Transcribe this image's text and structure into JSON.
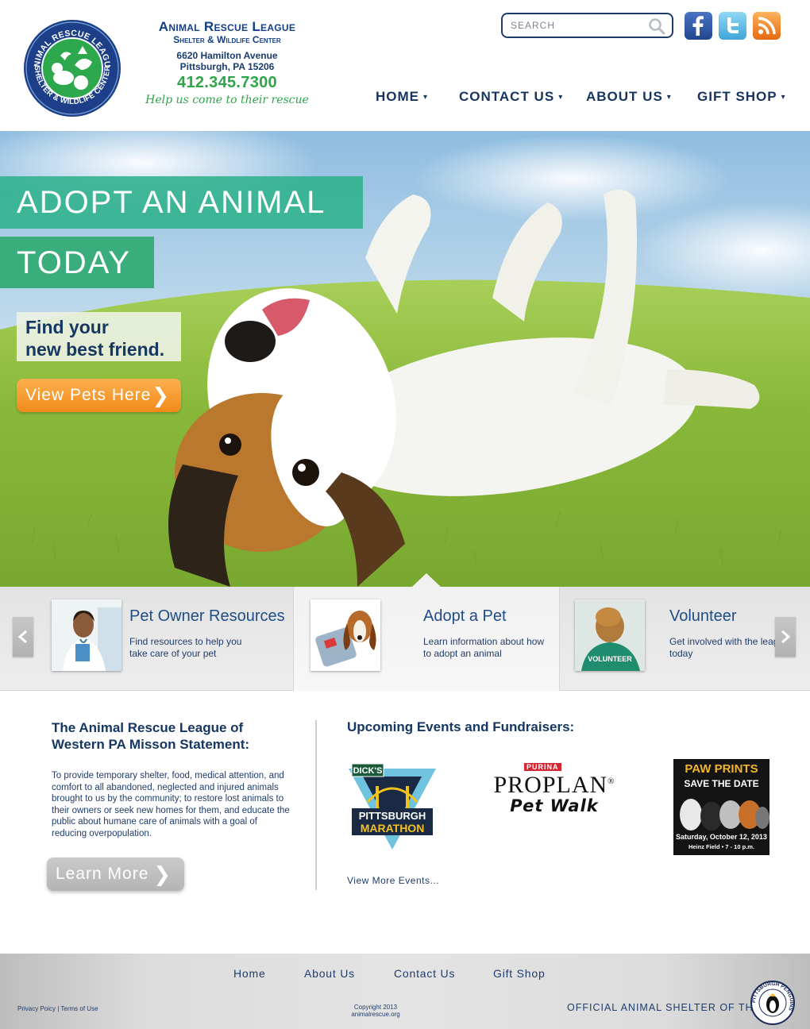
{
  "header": {
    "org_name": "Animal Rescue League",
    "org_subtitle": "Shelter & Wildlife Center",
    "address_line1": "6620 Hamilton Avenue",
    "address_line2": "Pittsburgh, PA 15206",
    "phone": "412.345.7300",
    "tagline": "Help us come to their rescue",
    "logo_ring_top": "ANIMAL RESCUE LEAGUE",
    "logo_ring_bottom": "SHELTER & WILDLIFE CENTER",
    "search_placeholder": "SEARCH",
    "social": [
      "facebook-icon",
      "twitter-icon",
      "rss-icon"
    ]
  },
  "nav": {
    "items": [
      {
        "label": "HOME",
        "caret": "▾"
      },
      {
        "label": "CONTACT US",
        "caret": "▾"
      },
      {
        "label": "ABOUT US",
        "caret": "▾"
      },
      {
        "label": "GIFT SHOP",
        "caret": "▾"
      }
    ]
  },
  "hero": {
    "banner_line1": "ADOPT AN ANIMAL",
    "banner_line2": "TODAY",
    "find_line1": "Find your",
    "find_line2": "new best friend.",
    "cta_label": "View Pets Here"
  },
  "features": [
    {
      "title": "Pet Owner Resources",
      "desc": "Find resources to help you take care of your pet"
    },
    {
      "title": "Adopt a Pet",
      "desc": "Learn information about how to adopt an animal"
    },
    {
      "title": "Volunteer",
      "desc": "Get involved with the league today"
    }
  ],
  "volunteer_shirt_text": "VOLUNTEER",
  "mission": {
    "title": "The Animal Rescue League of Western PA Misson Statement:",
    "body": "To provide temporary shelter, food, medical attention, and comfort to all abandoned, neglected and injured animals brought to us by the community; to restore lost animals to their owners or seek new homes for them, and educate the public about humane care of animals with a goal of reducing overpopulation.",
    "button_label": "Learn More"
  },
  "events": {
    "title": "Upcoming Events and Fundraisers:",
    "marathon": {
      "sponsor": "DICK'S",
      "line1": "PITTSBURGH",
      "line2": "MARATHON"
    },
    "proplan": {
      "brand": "PURINA",
      "name": "PROPLAN",
      "mark": "®",
      "event": "Pet Walk"
    },
    "pawprints": {
      "title": "PAW PRINTS",
      "subtitle": "SAVE THE DATE",
      "date": "Saturday, October 12, 2013",
      "venue": "Heinz Field  •  7 - 10 p.m."
    },
    "view_more": "View More Events..."
  },
  "footer": {
    "links": [
      "Home",
      "About Us",
      "Contact Us",
      "Gift Shop"
    ],
    "privacy": "Privacy Poicy",
    "separator": "|",
    "terms": "Terms of Use",
    "copyright_line1": "Copyright 2013",
    "copyright_line2": "animalrescue.org",
    "official": "OFFICIAL ANIMAL SHELTER OF THE",
    "penguins_text": "PITTSBURGH PENGUINS"
  },
  "colors": {
    "brand_navy": "#1f3d6b",
    "brand_green": "#2fa54a",
    "banner_teal": "#2fb28c",
    "cta_orange": "#f28a1a"
  }
}
